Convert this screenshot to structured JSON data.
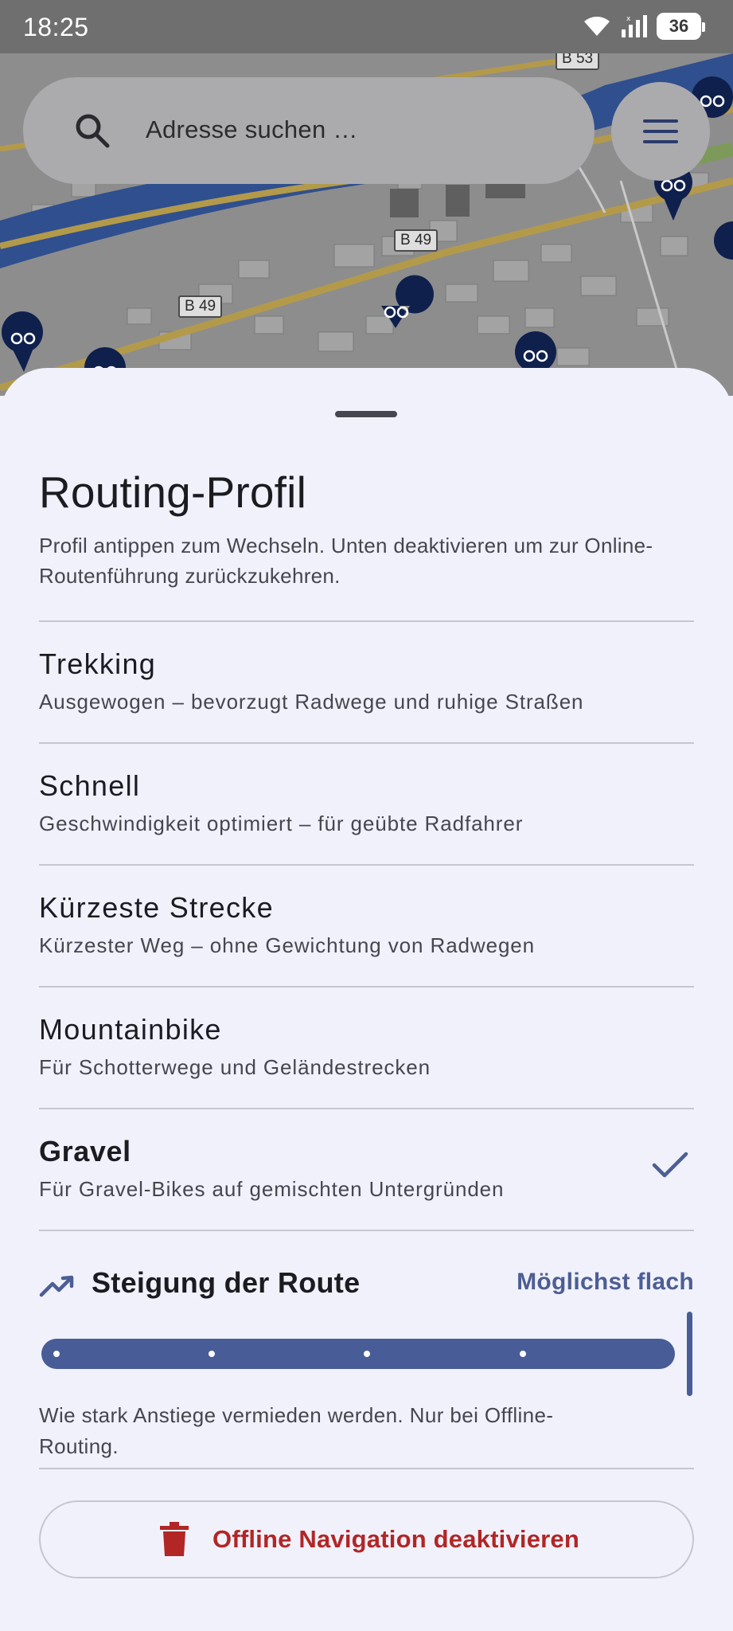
{
  "status_bar": {
    "time": "18:25",
    "battery": "36"
  },
  "map": {
    "search_placeholder": "Adresse suchen …",
    "road_labels": [
      "B 53",
      "B 49",
      "B 49"
    ]
  },
  "sheet": {
    "title": "Routing-Profil",
    "description": "Profil antippen zum Wechseln. Unten deaktivieren um zur Online-Routenführung zurückzukehren.",
    "profiles": [
      {
        "name": "Trekking",
        "description": "Ausgewogen – bevorzugt Radwege und ruhige Straßen",
        "selected": false
      },
      {
        "name": "Schnell",
        "description": "Geschwindigkeit optimiert – für geübte Radfahrer",
        "selected": false
      },
      {
        "name": "Kürzeste Strecke",
        "description": "Kürzester Weg – ohne Gewichtung von Radwegen",
        "selected": false
      },
      {
        "name": "Mountainbike",
        "description": "Für Schotterwege und Geländestrecken",
        "selected": false
      },
      {
        "name": "Gravel",
        "description": "Für Gravel-Bikes auf gemischten Untergründen",
        "selected": true
      }
    ],
    "incline": {
      "title": "Steigung der Route",
      "value": "Möglichst flach",
      "slider_level": 1.0,
      "slider_steps": 5,
      "note": "Wie stark Anstiege vermieden werden. Nur bei Offline-Routing."
    },
    "deactivate_label": "Offline Navigation deaktivieren"
  },
  "colors": {
    "accent": "#485d97",
    "danger": "#b22626",
    "sheet_bg": "#f1f1fb",
    "river": "#2f4f8f",
    "marker": "#10204d"
  },
  "icons": [
    "search-icon",
    "menu-icon",
    "wifi-icon",
    "signal-icon",
    "battery-icon",
    "bike-marker-icon",
    "checkmark-icon",
    "trending-up-icon",
    "trash-icon"
  ]
}
